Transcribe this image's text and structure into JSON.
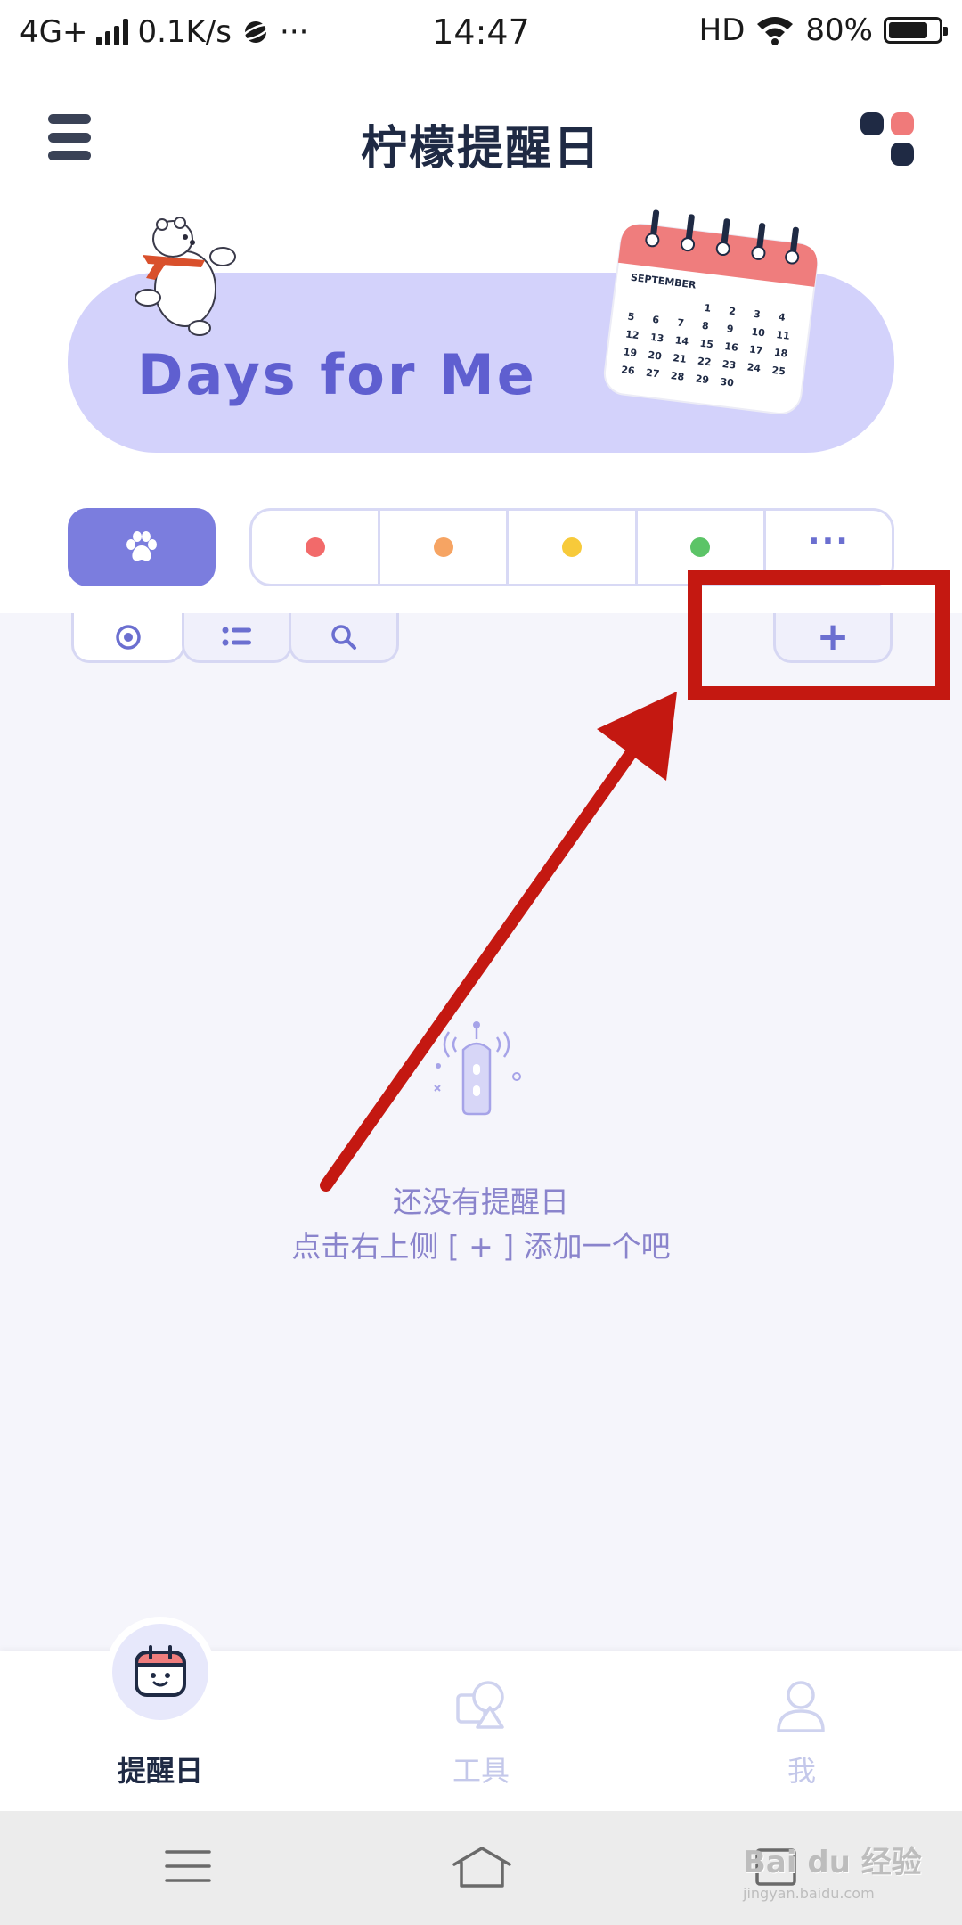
{
  "status_bar": {
    "network": "4G+",
    "speed": "0.1K/s",
    "more": "···",
    "time": "14:47",
    "hd": "HD",
    "battery_percent": "80%",
    "battery_level": 0.8
  },
  "header": {
    "title": "柠檬提醒日",
    "dot_colors": [
      "#1f2a44",
      "#f07a7a",
      "#1f2a44"
    ]
  },
  "banner": {
    "text": "Days for Me",
    "calendar_month": "SEPTEMBER",
    "calendar_days": [
      "1",
      "2",
      "3",
      "4",
      "5",
      "6",
      "7",
      "8",
      "9",
      "10",
      "11",
      "12",
      "13",
      "14",
      "15",
      "16",
      "17",
      "18",
      "19",
      "20",
      "21",
      "22",
      "23",
      "24",
      "25",
      "26",
      "27",
      "28",
      "29",
      "30"
    ]
  },
  "categories": {
    "selected_icon": "paw-icon",
    "colors": [
      "#f26a6a",
      "#f6a463",
      "#f7ca3a",
      "#5cc467"
    ],
    "more_label": "···"
  },
  "view_tabs": [
    {
      "icon": "target-icon",
      "active": true
    },
    {
      "icon": "list-icon",
      "active": false
    },
    {
      "icon": "search-icon",
      "active": false
    }
  ],
  "add_button": {
    "label": "+"
  },
  "empty_state": {
    "line1": "还没有提醒日",
    "line2": "点击右上侧 [ + ] 添加一个吧"
  },
  "bottom_nav": [
    {
      "label": "提醒日",
      "icon": "calendar-face-icon",
      "active": true
    },
    {
      "label": "工具",
      "icon": "tools-icon",
      "active": false
    },
    {
      "label": "我",
      "icon": "user-icon",
      "active": false
    }
  ],
  "watermark": {
    "brand": "Bai du 经验",
    "url": "jingyan.baidu.com"
  },
  "colors": {
    "accent": "#7b7dde",
    "banner_bg": "#d3d2fb",
    "banner_text": "#5f5fd0",
    "annotation_red": "#c41811",
    "content_bg": "#f5f5fb"
  }
}
